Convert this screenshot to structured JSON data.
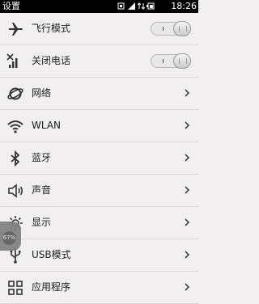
{
  "status_bar": {
    "title": "设置",
    "time": "18:26",
    "icons": [
      "app-notification-icon",
      "signal-icon",
      "data-arrows-icon",
      "battery-icon"
    ]
  },
  "settings": [
    {
      "label": "飞行模式",
      "icon": "airplane-icon",
      "control": "toggle",
      "state": "off"
    },
    {
      "label": "关闭电话",
      "icon": "phone-signal-off-icon",
      "control": "toggle",
      "state": "off"
    },
    {
      "label": "网络",
      "icon": "network-globe-icon",
      "control": "chevron"
    },
    {
      "label": "WLAN",
      "icon": "wifi-icon",
      "control": "chevron"
    },
    {
      "label": "蓝牙",
      "icon": "bluetooth-icon",
      "control": "chevron"
    },
    {
      "label": "声音",
      "icon": "speaker-icon",
      "control": "chevron"
    },
    {
      "label": "显示",
      "icon": "brightness-icon",
      "control": "chevron"
    },
    {
      "label": "USB模式",
      "icon": "usb-icon",
      "control": "chevron"
    },
    {
      "label": "应用程序",
      "icon": "apps-grid-icon",
      "control": "chevron"
    }
  ],
  "floating_widget": {
    "value": "67%"
  }
}
